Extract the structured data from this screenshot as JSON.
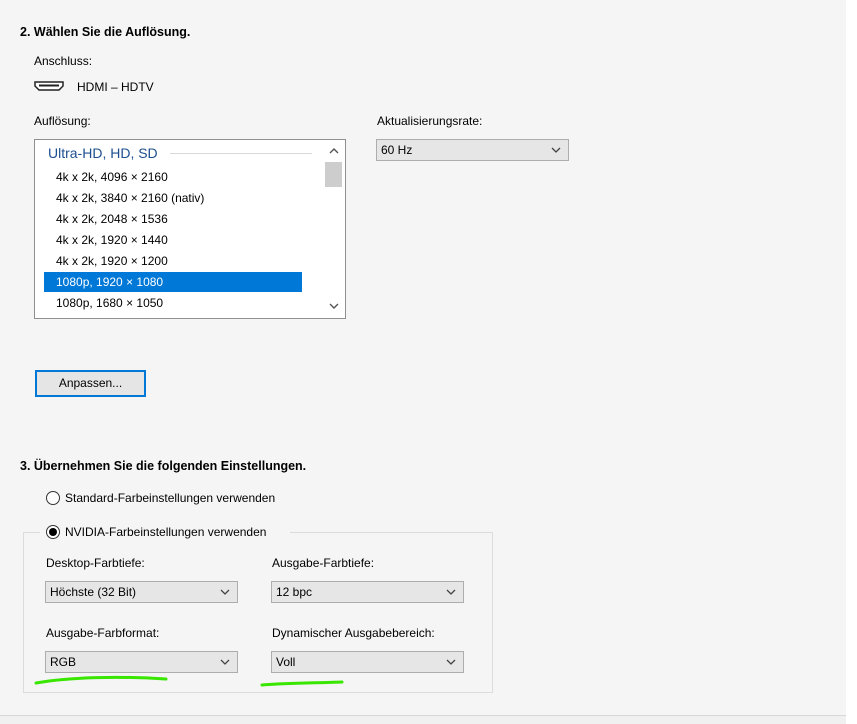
{
  "section2": {
    "heading": "2. Wählen Sie die Auflösung.",
    "connection_label": "Anschluss:",
    "connection_value": "HDMI – HDTV",
    "connection_icon": "hdmi-icon",
    "resolution_label": "Auflösung:",
    "refresh_label": "Aktualisierungsrate:",
    "refresh_value": "60 Hz",
    "resolution_group": "Ultra-HD, HD, SD",
    "resolutions": [
      "4k x 2k, 4096 × 2160",
      "4k x 2k, 3840 × 2160 (nativ)",
      "4k x 2k, 2048 × 1536",
      "4k x 2k, 1920 × 1440",
      "4k x 2k, 1920 × 1200",
      "1080p, 1920 × 1080",
      "1080p, 1680 × 1050"
    ],
    "selected_resolution": "1080p, 1920 × 1080",
    "customize_button": "Anpassen..."
  },
  "section3": {
    "heading": "3. Übernehmen Sie die folgenden Einstellungen.",
    "radio_default": "Standard-Farbeinstellungen verwenden",
    "radio_nvidia": "NVIDIA-Farbeinstellungen verwenden",
    "selected_radio": "radio_nvidia",
    "desktop_depth_label": "Desktop-Farbtiefe:",
    "desktop_depth_value": "Höchste (32 Bit)",
    "output_depth_label": "Ausgabe-Farbtiefe:",
    "output_depth_value": "12 bpc",
    "output_format_label": "Ausgabe-Farbformat:",
    "output_format_value": "RGB",
    "dynamic_range_label": "Dynamischer Ausgabebereich:",
    "dynamic_range_value": "Voll"
  },
  "colors": {
    "selection": "#0078d7",
    "group_header": "#1c4f8f",
    "annotation_highlight": "#39e600"
  }
}
